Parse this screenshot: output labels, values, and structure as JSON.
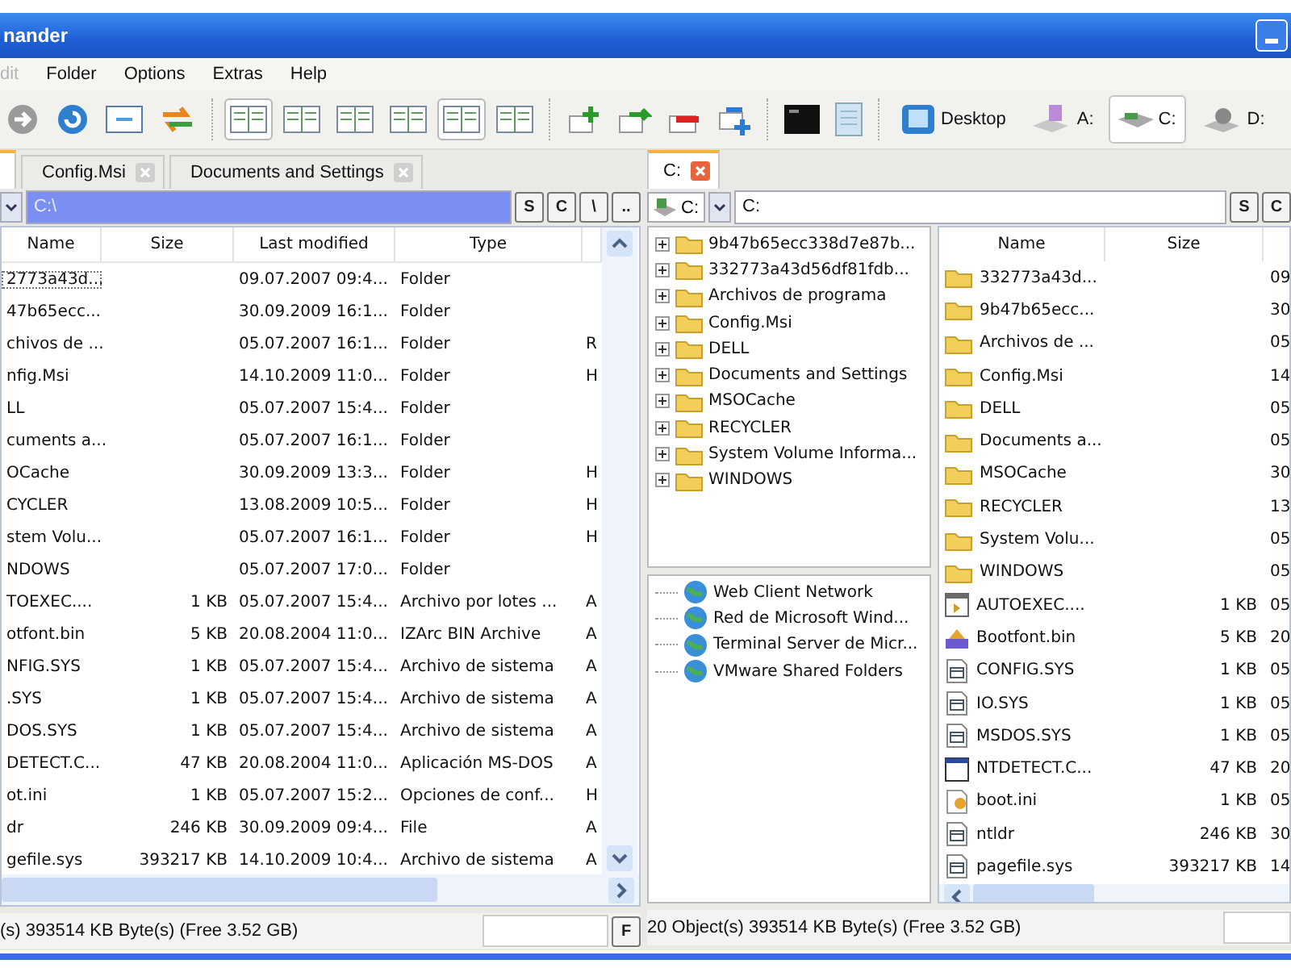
{
  "window": {
    "title": "nander"
  },
  "menu": [
    {
      "label": "dit",
      "disabled": true
    },
    {
      "label": "Folder",
      "disabled": false
    },
    {
      "label": "Options",
      "disabled": false
    },
    {
      "label": "Extras",
      "disabled": false
    },
    {
      "label": "Help",
      "disabled": false
    }
  ],
  "toolbar": {
    "layouts": [
      {
        "selected": true
      },
      {
        "selected": false
      },
      {
        "selected": false
      },
      {
        "selected": false
      },
      {
        "selected": true
      },
      {
        "selected": false
      }
    ],
    "drives": [
      {
        "label": "Desktop",
        "kind": "desktop",
        "selected": false
      },
      {
        "label": "A:",
        "kind": "floppy",
        "selected": false
      },
      {
        "label": "C:",
        "kind": "hdd",
        "selected": true
      },
      {
        "label": "D:",
        "kind": "cdrom",
        "selected": false
      }
    ]
  },
  "left_pane": {
    "tabs": [
      {
        "label": "Config.Msi",
        "selected": false
      },
      {
        "label": "Documents and Settings",
        "selected": false
      }
    ],
    "path": "C:\\",
    "path_buttons": [
      "S",
      "C",
      "\\",
      ".."
    ],
    "columns": [
      "Name",
      "Size",
      "Last modified",
      "Type"
    ],
    "rows": [
      {
        "name": "2773a43d...",
        "size": "",
        "modified": "09.07.2007 09:4...",
        "type": "Folder",
        "column_5": ""
      },
      {
        "name": "47b65ecc...",
        "size": "",
        "modified": "30.09.2009 16:1...",
        "type": "Folder",
        "column_5": ""
      },
      {
        "name": "chivos de ...",
        "size": "",
        "modified": "05.07.2007 16:1...",
        "type": "Folder",
        "column_5": "R"
      },
      {
        "name": "nfig.Msi",
        "size": "",
        "modified": "14.10.2009 11:0...",
        "type": "Folder",
        "column_5": "H"
      },
      {
        "name": "LL",
        "size": "",
        "modified": "05.07.2007 15:4...",
        "type": "Folder",
        "column_5": ""
      },
      {
        "name": "cuments a...",
        "size": "",
        "modified": "05.07.2007 16:1...",
        "type": "Folder",
        "column_5": ""
      },
      {
        "name": "OCache",
        "size": "",
        "modified": "30.09.2009 13:3...",
        "type": "Folder",
        "column_5": "H"
      },
      {
        "name": "CYCLER",
        "size": "",
        "modified": "13.08.2009 10:5...",
        "type": "Folder",
        "column_5": "H"
      },
      {
        "name": "stem Volu...",
        "size": "",
        "modified": "05.07.2007 16:1...",
        "type": "Folder",
        "column_5": "H"
      },
      {
        "name": "NDOWS",
        "size": "",
        "modified": "05.07.2007 17:0...",
        "type": "Folder",
        "column_5": ""
      },
      {
        "name": "TOEXEC....",
        "size": "1 KB",
        "modified": "05.07.2007 15:4...",
        "type": "Archivo por lotes ...",
        "column_5": "A"
      },
      {
        "name": "otfont.bin",
        "size": "5 KB",
        "modified": "20.08.2004 11:0...",
        "type": "IZArc BIN Archive",
        "column_5": "A"
      },
      {
        "name": "NFIG.SYS",
        "size": "1 KB",
        "modified": "05.07.2007 15:4...",
        "type": "Archivo de sistema",
        "column_5": "A"
      },
      {
        "name": ".SYS",
        "size": "1 KB",
        "modified": "05.07.2007 15:4...",
        "type": "Archivo de sistema",
        "column_5": "A"
      },
      {
        "name": "DOS.SYS",
        "size": "1 KB",
        "modified": "05.07.2007 15:4...",
        "type": "Archivo de sistema",
        "column_5": "A"
      },
      {
        "name": "DETECT.C...",
        "size": "47 KB",
        "modified": "20.08.2004 11:0...",
        "type": "Aplicación MS-DOS",
        "column_5": "A"
      },
      {
        "name": "ot.ini",
        "size": "1 KB",
        "modified": "05.07.2007 15:2...",
        "type": "Opciones de conf...",
        "column_5": "H"
      },
      {
        "name": "dr",
        "size": "246 KB",
        "modified": "30.09.2009 09:4...",
        "type": "File",
        "column_5": "A"
      },
      {
        "name": "gefile.sys",
        "size": "393217 KB",
        "modified": "14.10.2009 10:4...",
        "type": "Archivo de sistema",
        "column_5": "A"
      }
    ],
    "status": "(s) 393514 KB Byte(s) (Free 3.52 GB)",
    "filter_button": "F"
  },
  "right_pane": {
    "tabs": [
      {
        "label": "C:",
        "selected": true
      }
    ],
    "drive": "C:",
    "path": "C:",
    "path_buttons": [
      "S",
      "C"
    ],
    "tree": [
      {
        "label": "9b47b65ecc338d7e87b...",
        "expanded": false
      },
      {
        "label": "332773a43d56df81fdb...",
        "expanded": false
      },
      {
        "label": "Archivos de programa",
        "expanded": false
      },
      {
        "label": "Config.Msi",
        "expanded": false
      },
      {
        "label": "DELL",
        "expanded": false
      },
      {
        "label": "Documents and Settings",
        "expanded": false
      },
      {
        "label": "MSOCache",
        "expanded": false
      },
      {
        "label": "RECYCLER",
        "expanded": false
      },
      {
        "label": "System Volume Informa...",
        "expanded": false
      },
      {
        "label": "WINDOWS",
        "expanded": false
      }
    ],
    "network": [
      "Web Client Network",
      "Red de Microsoft Wind...",
      "Terminal Server de Micr...",
      "VMware Shared Folders"
    ],
    "columns": [
      "Name",
      "Size"
    ],
    "rows": [
      {
        "name": "332773a43d...",
        "kind": "folder",
        "size": "",
        "column_3": "09"
      },
      {
        "name": "9b47b65ecc...",
        "kind": "folder",
        "size": "",
        "column_3": "30"
      },
      {
        "name": "Archivos de ...",
        "kind": "folder",
        "size": "",
        "column_3": "05"
      },
      {
        "name": "Config.Msi",
        "kind": "folder",
        "size": "",
        "column_3": "14"
      },
      {
        "name": "DELL",
        "kind": "folder",
        "size": "",
        "column_3": "05"
      },
      {
        "name": "Documents a...",
        "kind": "folder",
        "size": "",
        "column_3": "05"
      },
      {
        "name": "MSOCache",
        "kind": "folder",
        "size": "",
        "column_3": "30"
      },
      {
        "name": "RECYCLER",
        "kind": "folder",
        "size": "",
        "column_3": "13"
      },
      {
        "name": "System Volu...",
        "kind": "folder",
        "size": "",
        "column_3": "05"
      },
      {
        "name": "WINDOWS",
        "kind": "folder",
        "size": "",
        "column_3": "05"
      },
      {
        "name": "AUTOEXEC....",
        "kind": "batch",
        "size": "1 KB",
        "column_3": "05"
      },
      {
        "name": "Bootfont.bin",
        "kind": "archive",
        "size": "5 KB",
        "column_3": "20"
      },
      {
        "name": "CONFIG.SYS",
        "kind": "system",
        "size": "1 KB",
        "column_3": "05"
      },
      {
        "name": "IO.SYS",
        "kind": "system",
        "size": "1 KB",
        "column_3": "05"
      },
      {
        "name": "MSDOS.SYS",
        "kind": "system",
        "size": "1 KB",
        "column_3": "05"
      },
      {
        "name": "NTDETECT.C...",
        "kind": "program",
        "size": "47 KB",
        "column_3": "20"
      },
      {
        "name": "boot.ini",
        "kind": "settings",
        "size": "1 KB",
        "column_3": "05"
      },
      {
        "name": "ntldr",
        "kind": "system",
        "size": "246 KB",
        "column_3": "30"
      },
      {
        "name": "pagefile.sys",
        "kind": "system",
        "size": "393217 KB",
        "column_3": "14"
      }
    ],
    "status": "20 Object(s) 393514 KB Byte(s) (Free 3.52 GB)"
  }
}
